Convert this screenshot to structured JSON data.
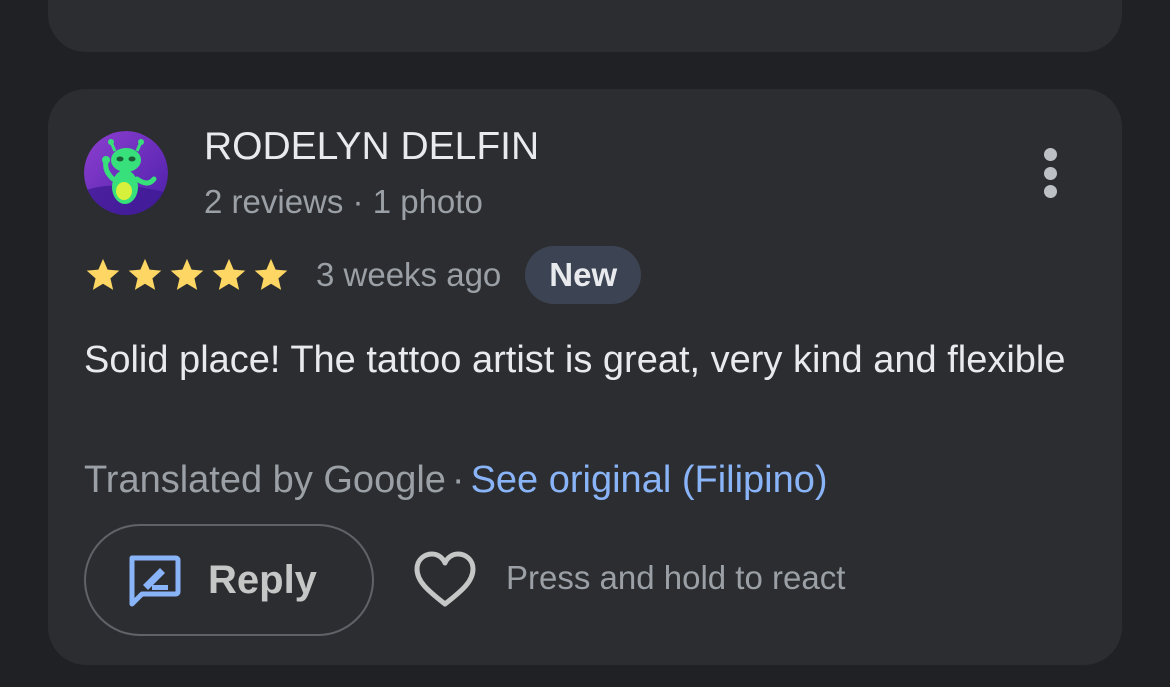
{
  "review": {
    "author": {
      "name": "RODELYN DELFIN",
      "meta": "2 reviews · 1 photo",
      "avatar_icon": "alien-avatar-icon"
    },
    "rating": 5,
    "rating_max": 5,
    "time_ago": "3 weeks ago",
    "badge": "New",
    "text": "Solid place! The tattoo artist is great, very kind and flexible",
    "translated_by": "Translated by Google",
    "separator": "·",
    "see_original": "See original (Filipino)",
    "reply_label": "Reply",
    "react_hint": "Press and hold to react"
  },
  "colors": {
    "background": "#202124",
    "card": "#2c2d30",
    "star": "#fdd663",
    "link": "#8ab4f8",
    "badge_bg": "#3c4352",
    "reply_icon": "#8ab4f8"
  }
}
